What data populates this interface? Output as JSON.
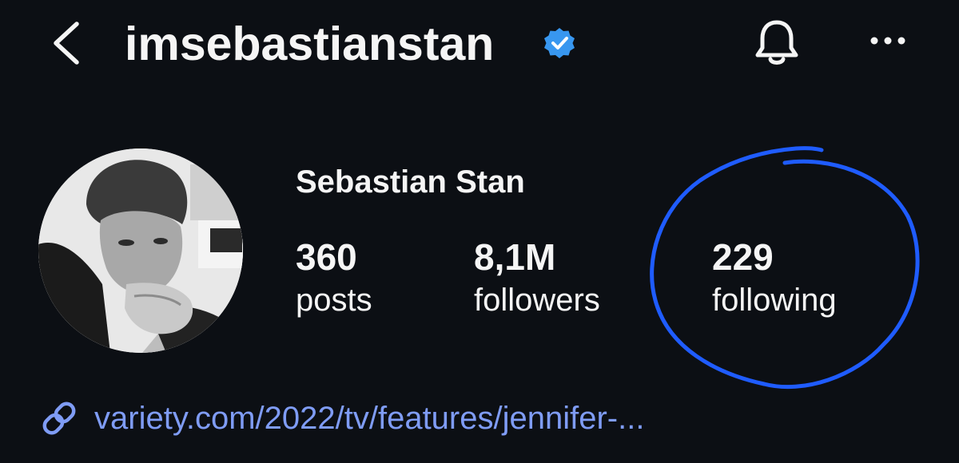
{
  "header": {
    "username": "imsebastianstan",
    "back_icon": "chevron-left-icon",
    "verified_icon": "verified-badge-icon",
    "notifications_icon": "bell-icon",
    "more_icon": "more-horizontal-icon"
  },
  "profile": {
    "display_name": "Sebastian Stan",
    "stats": [
      {
        "count": "360",
        "label": "posts"
      },
      {
        "count": "8,1M",
        "label": "followers"
      },
      {
        "count": "229",
        "label": "following"
      }
    ],
    "link_icon": "link-icon",
    "link": "variety.com/2022/tv/features/jennifer-..."
  },
  "colors": {
    "background": "#0c0f14",
    "text": "#f5f5f5",
    "verified_blue": "#3897f0",
    "link": "#7f9cf5",
    "annotation_circle": "#1f5cff"
  }
}
